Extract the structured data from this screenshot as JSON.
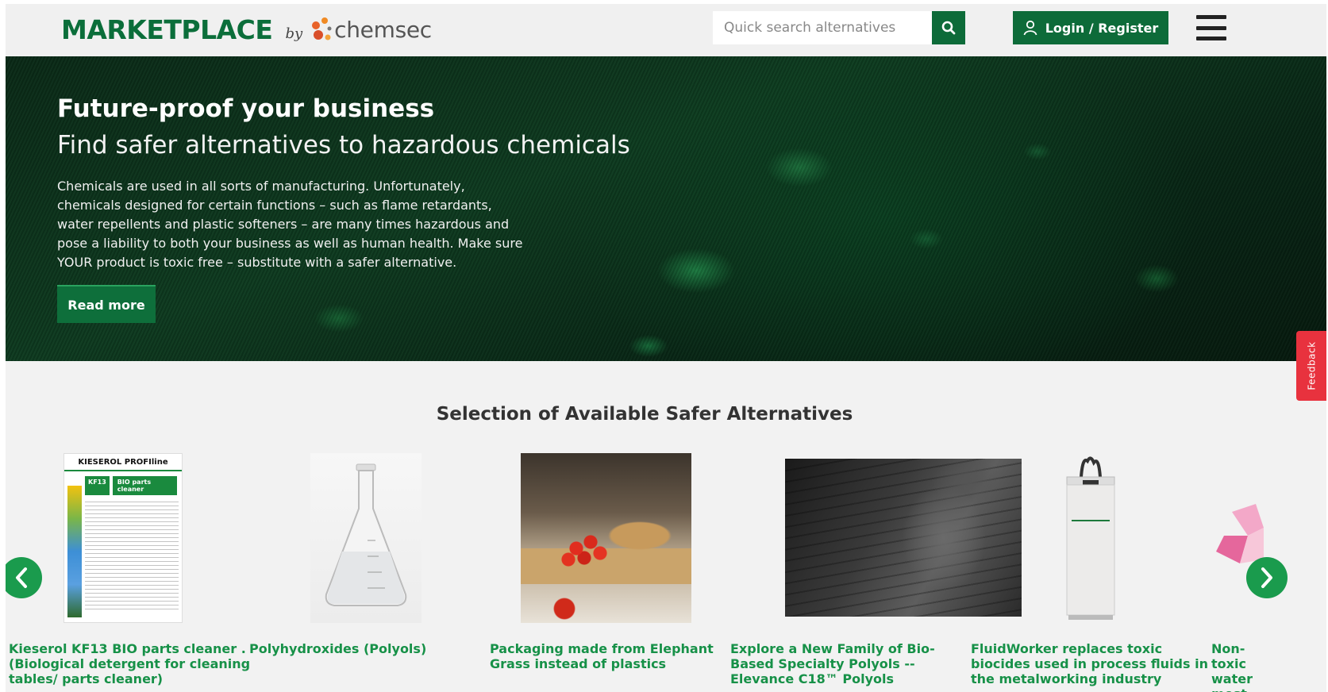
{
  "header": {
    "logo_marketplace": "MARKETPLACE",
    "logo_by": "by",
    "logo_chemsec": "chemsec",
    "search_placeholder": "Quick search alternatives",
    "login_label": "Login / Register"
  },
  "hero": {
    "title": "Future-proof your business",
    "subtitle": "Find safer alternatives to hazardous chemicals",
    "text": "Chemicals are used in all sorts of manufacturing. Unfortunately, chemicals designed for certain functions – such as flame retardants, water repellents and plastic softeners – are many times hazardous and pose a liability to both your business as well as human health. Make sure YOUR product is toxic free – substitute with a safer alternative.",
    "button_label": "Read more"
  },
  "feedback_label": "Feedback",
  "selection": {
    "title": "Selection of Available Safer Alternatives",
    "cards": [
      {
        "title": "Kieserol KF13 BIO parts cleaner . (Biological detergent for cleaning tables/ parts cleaner)",
        "image_brand": "KIESEROL PROFIline",
        "image_product": "KF13",
        "image_product_name": "BIO parts cleaner"
      },
      {
        "title": "Polyhydroxides (Polyols)"
      },
      {
        "title": "Packaging made from Elephant Grass instead of plastics"
      },
      {
        "title": "Explore a New Family of Bio-Based Specialty Polyols -- Elevance C18™ Polyols"
      },
      {
        "title": "FluidWorker replaces toxic biocides used in process fluids in the metalworking industry"
      },
      {
        "title": "Non-toxic water most finish"
      }
    ]
  },
  "colors": {
    "brand_green": "#0d6b39",
    "link_green": "#179148",
    "arrow_green": "#1a9b4d",
    "feedback_red": "#e8323e"
  }
}
